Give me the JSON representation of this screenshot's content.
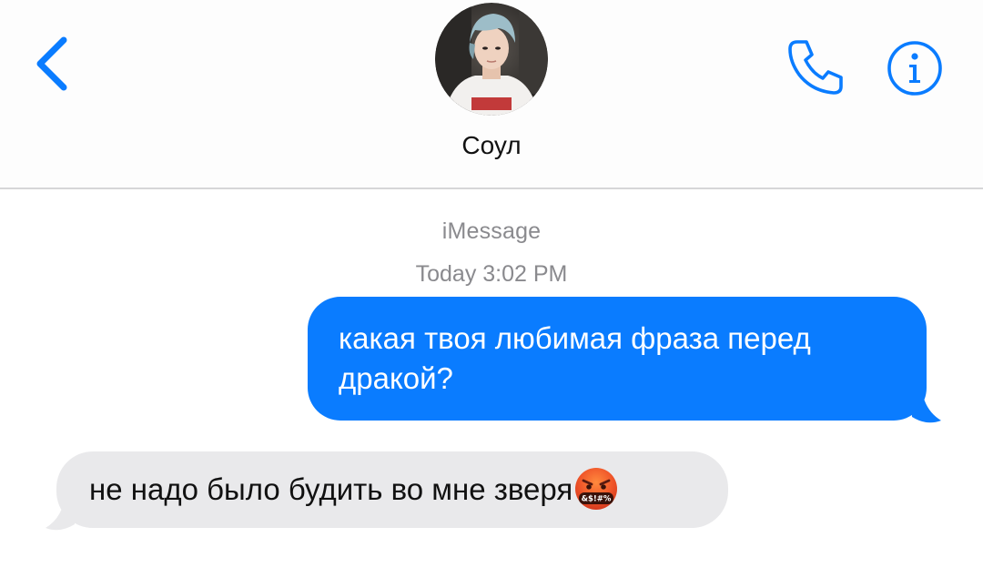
{
  "header": {
    "contact_name": "Соул",
    "back_icon": "chevron-left-icon",
    "phone_icon": "phone-icon",
    "info_icon": "info-icon",
    "avatar": "contact-avatar-photo",
    "accent_color": "#0a7cff"
  },
  "thread": {
    "service_label": "iMessage",
    "timestamp": "Today 3:02 PM",
    "messages": [
      {
        "direction": "sent",
        "text": "какая твоя любимая фраза перед дракой?",
        "bubble_color": "#0a7cff"
      },
      {
        "direction": "received",
        "text": "не надо было будить во мне зверя",
        "emoji": "face-with-symbols-on-mouth",
        "emoji_symbols": "&$!#%",
        "bubble_color": "#e9e9eb"
      }
    ]
  }
}
